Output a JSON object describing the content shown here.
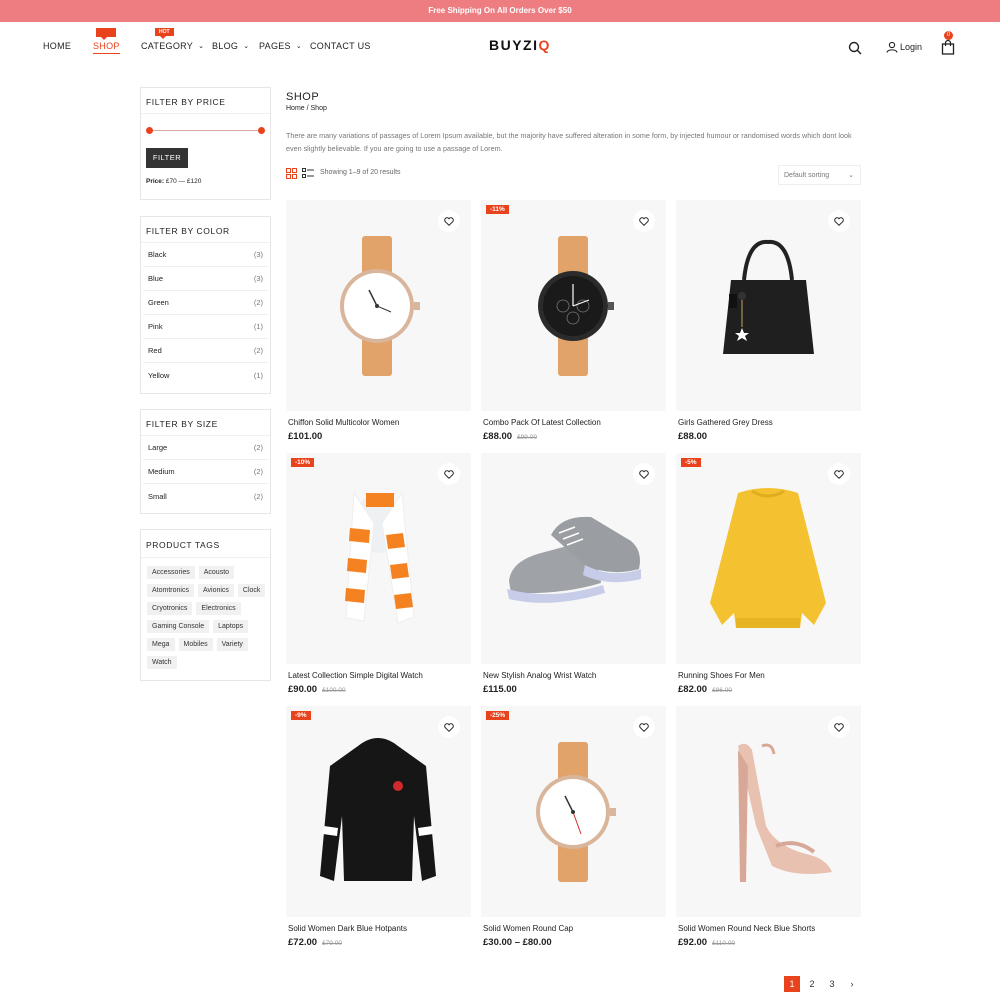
{
  "topbar": {
    "text": "Free Shipping On All Orders Over $50"
  },
  "nav": {
    "home": "HOME",
    "shop": "SHOP",
    "category": "CATEGORY",
    "blog": "BLOG",
    "pages": "PAGES",
    "contact": "CONTACT US",
    "hot_badge": "HOT"
  },
  "brand": {
    "logo_main": "BUYZI",
    "logo_accent": "Q"
  },
  "header": {
    "login": "Login",
    "cart_count": "0"
  },
  "sidebar": {
    "price": {
      "title": "FILTER BY PRICE",
      "button": "FILTER",
      "label": "Price:",
      "range": "£70 — £120"
    },
    "color": {
      "title": "FILTER BY COLOR",
      "items": [
        {
          "label": "Black",
          "count": "(3)"
        },
        {
          "label": "Blue",
          "count": "(3)"
        },
        {
          "label": "Green",
          "count": "(2)"
        },
        {
          "label": "Pink",
          "count": "(1)"
        },
        {
          "label": "Red",
          "count": "(2)"
        },
        {
          "label": "Yellow",
          "count": "(1)"
        }
      ]
    },
    "size": {
      "title": "FILTER BY SIZE",
      "items": [
        {
          "label": "Large",
          "count": "(2)"
        },
        {
          "label": "Medium",
          "count": "(2)"
        },
        {
          "label": "Small",
          "count": "(2)"
        }
      ]
    },
    "tags": {
      "title": "PRODUCT TAGS",
      "items": [
        "Accessories",
        "Acousto",
        "Atomtronics",
        "Avionics",
        "Clock",
        "Cryotronics",
        "Electronics",
        "Gaming Console",
        "Laptops",
        "Mega",
        "Mobiles",
        "Variety",
        "Watch"
      ]
    }
  },
  "main": {
    "title": "SHOP",
    "breadcrumb": "Home / Shop",
    "description": "There are many variations of passages of Lorem Ipsum available, but the majority have suffered alteration in some form, by injected humour or randomised words which dont look even slightly believable. If you are going to use a passage of Lorem.",
    "showing": "Showing 1–9 of 20 results",
    "sort": "Default sorting"
  },
  "products": [
    {
      "name": "Chiffon Solid Multicolor Women",
      "price": "£101.00",
      "old": "",
      "sale": "",
      "image": "white-dial-watch"
    },
    {
      "name": "Combo Pack Of Latest Collection",
      "price": "£88.00",
      "old": "£99.00",
      "sale": "-11%",
      "image": "black-dial-watch"
    },
    {
      "name": "Girls Gathered Grey Dress",
      "price": "£88.00",
      "old": "",
      "sale": "",
      "image": "black-handbag"
    },
    {
      "name": "Latest Collection Simple Digital Watch",
      "price": "£90.00",
      "old": "£100.00",
      "sale": "-10%",
      "image": "orange-scarf"
    },
    {
      "name": "New Stylish Analog Wrist Watch",
      "price": "£115.00",
      "old": "",
      "sale": "",
      "image": "grey-sneaker"
    },
    {
      "name": "Running Shoes For Men",
      "price": "£82.00",
      "old": "£86.00",
      "sale": "-5%",
      "image": "yellow-sweater"
    },
    {
      "name": "Solid Women Dark Blue Hotpants",
      "price": "£72.00",
      "old": "£79.00",
      "sale": "-9%",
      "image": "black-hoodie"
    },
    {
      "name": "Solid Women Round Cap",
      "price": "£30.00 – £80.00",
      "old": "",
      "sale": "-25%",
      "image": "white-dial-watch"
    },
    {
      "name": "Solid Women Round Neck Blue Shorts",
      "price": "£92.00",
      "old": "£110.00",
      "sale": "",
      "image": "nude-heel-sandal"
    }
  ],
  "pagination": {
    "pages": [
      "1",
      "2",
      "3"
    ],
    "current": "1",
    "next": "›"
  },
  "colors": {
    "accent": "#e8431c",
    "topbar": "#ee7d82"
  }
}
